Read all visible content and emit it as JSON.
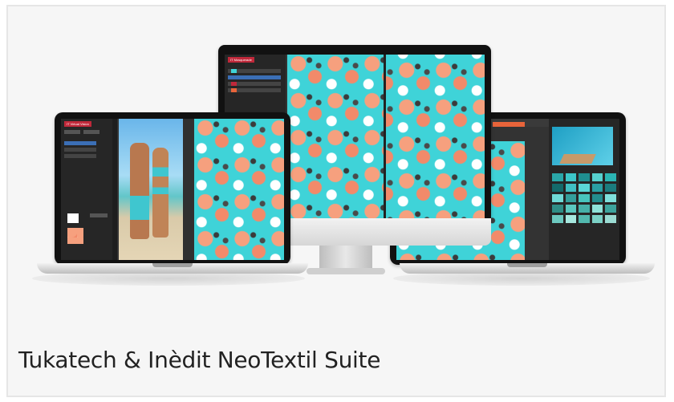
{
  "caption": "Tukatech & Inèdit NeoTextil Suite",
  "images": {
    "hero": "Laptop, desktop monitor and laptop displaying Inèdit NeoTextil software with turquoise floral print designs"
  },
  "colors": {
    "pattern_bg": "#3fd3d8",
    "flower_coral": "#f6a07e",
    "app_red": "#c0283a",
    "panel_dark": "#2b2b2b"
  }
}
